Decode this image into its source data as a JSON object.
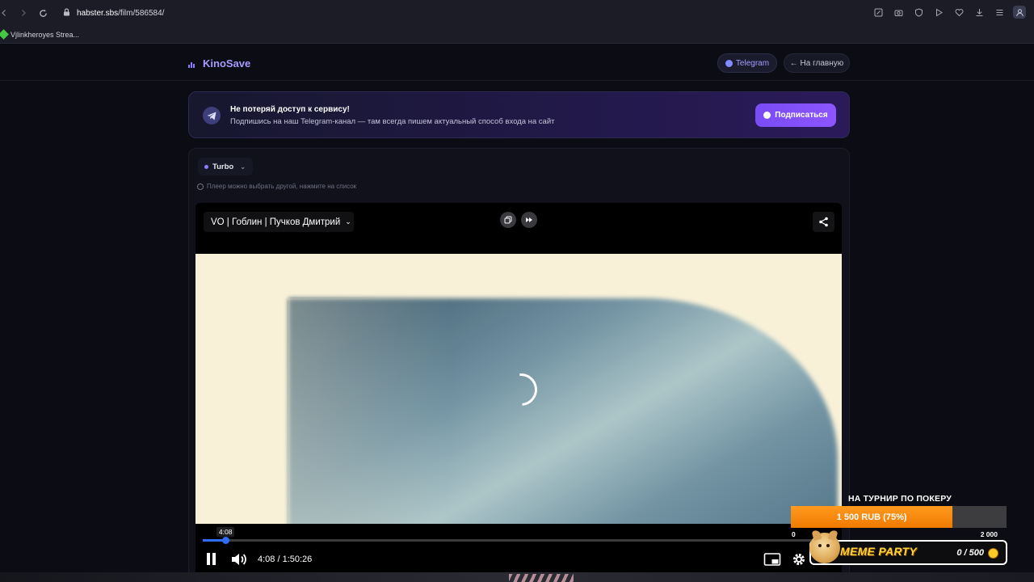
{
  "browser": {
    "url_host": "habster.sbs",
    "url_path": "/film/586584/",
    "bookmark_label": "Vjlinkheroyes Strea..."
  },
  "site": {
    "logo": "KinoSave",
    "telegram_button": "Telegram",
    "home_button": "← На главную"
  },
  "banner": {
    "title": "Не потеряй доступ к сервису!",
    "subtitle": "Подпишись на наш Telegram-канал — там всегда пишем актуальный способ входа на сайт",
    "button": "Подписаться"
  },
  "player_selector": {
    "selected": "Turbo",
    "hint": "Плеер можно выбрать другой, нажмите на список"
  },
  "player": {
    "voice": "VO | Гоблин | Пучков Дмитрий",
    "hover_time": "4:08",
    "current_time": "4:08",
    "duration": "1:50:26",
    "time_display": "4:08 / 1:50:26",
    "progress_fraction": 0.0374,
    "state": "playing",
    "loading": true
  },
  "poker_widget": {
    "title": "НА ТУРНИР ПО ПОКЕРУ",
    "progress_label": "1 500 RUB (75%)",
    "progress_fraction": 0.75,
    "min_label": "0",
    "max_label": "2 000",
    "brand": "MEME PARTY",
    "count": "0 / 500"
  },
  "colors": {
    "accent": "#8d7dff",
    "subscribe_button": "#7a4cf5",
    "progress": "#2f6dff",
    "poker_fill": "#f07a00"
  },
  "icons": {
    "back": "back-icon",
    "forward": "forward-icon",
    "reload": "reload-icon",
    "lock": "lock-icon",
    "share": "share-icon",
    "pause": "pause-icon",
    "volume": "volume-icon",
    "pip": "pip-icon",
    "settings": "gear-icon",
    "telegram": "telegram-icon"
  }
}
